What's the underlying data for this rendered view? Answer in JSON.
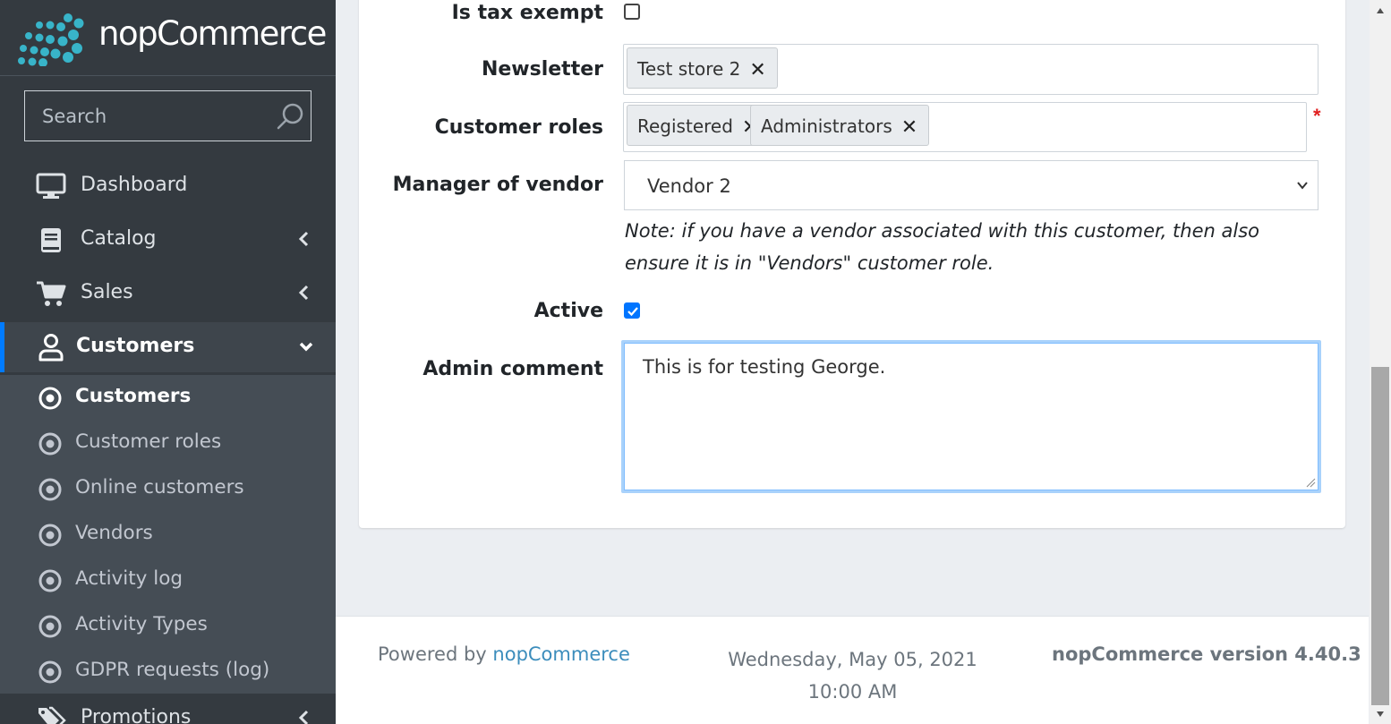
{
  "brand": {
    "name": "nopCommerce"
  },
  "search": {
    "placeholder": "Search",
    "value": ""
  },
  "nav": {
    "items": [
      {
        "label": "Dashboard",
        "icon": "monitor-icon",
        "has_chevron": false
      },
      {
        "label": "Catalog",
        "icon": "book-icon",
        "has_chevron": true
      },
      {
        "label": "Sales",
        "icon": "cart-icon",
        "has_chevron": true
      },
      {
        "label": "Customers",
        "icon": "user-icon",
        "has_chevron": true,
        "active": true
      },
      {
        "label": "Promotions",
        "icon": "tags-icon",
        "has_chevron": true
      }
    ],
    "submenu": [
      {
        "label": "Customers",
        "current": true
      },
      {
        "label": "Customer roles"
      },
      {
        "label": "Online customers"
      },
      {
        "label": "Vendors"
      },
      {
        "label": "Activity log"
      },
      {
        "label": "Activity Types"
      },
      {
        "label": "GDPR requests (log)"
      }
    ]
  },
  "form": {
    "tax_exempt": {
      "label": "Is tax exempt",
      "checked": false
    },
    "newsletter": {
      "label": "Newsletter",
      "tags": [
        "Test store 2"
      ],
      "remove_glyph": "✕"
    },
    "customer_roles": {
      "label": "Customer roles",
      "tags": [
        "Registered",
        "Administrators"
      ],
      "required_mark": "*"
    },
    "manager_of_vendor": {
      "label": "Manager of vendor",
      "value": "Vendor 2"
    },
    "vendor_note": "Note: if you have a vendor associated with this customer, then also ensure it is in \"Vendors\" customer role.",
    "active": {
      "label": "Active",
      "checked": true
    },
    "admin_comment": {
      "label": "Admin comment",
      "value": "This is for testing George."
    }
  },
  "footer": {
    "powered_prefix": "Powered by",
    "powered_link": "nopCommerce",
    "datetime": "Wednesday, May 05, 2021 10:00 AM",
    "version": "nopCommerce version 4.40.3"
  },
  "colors": {
    "sidebar_bg": "#343a40",
    "submenu_bg": "#454d55",
    "accent": "#007bff",
    "brand_teal": "#38b4c9",
    "link": "#3c8dbc",
    "required": "#e02020"
  }
}
